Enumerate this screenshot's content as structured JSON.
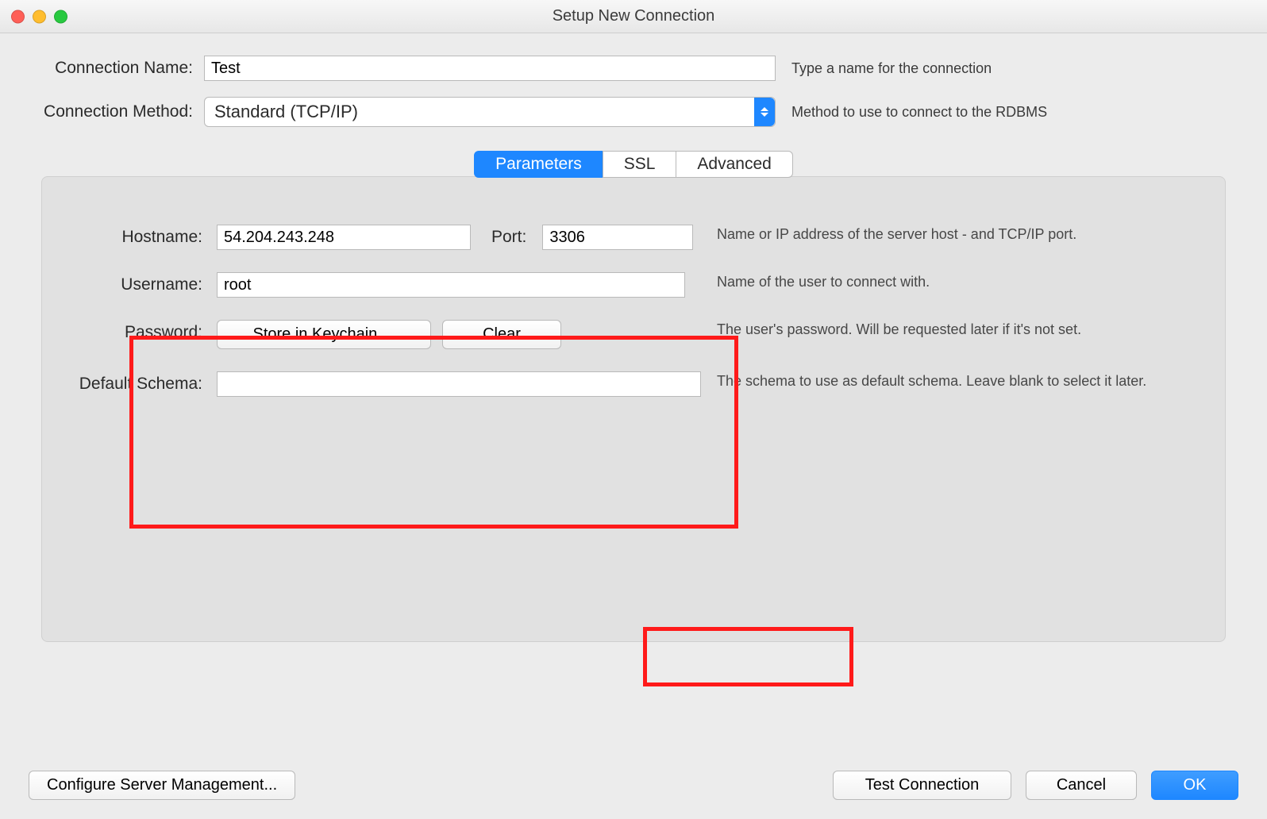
{
  "window": {
    "title": "Setup New Connection"
  },
  "connection_name": {
    "label": "Connection Name:",
    "value": "Test",
    "help": "Type a name for the connection"
  },
  "connection_method": {
    "label": "Connection Method:",
    "value": "Standard (TCP/IP)",
    "help": "Method to use to connect to the RDBMS"
  },
  "tabs": {
    "parameters": "Parameters",
    "ssl": "SSL",
    "advanced": "Advanced"
  },
  "params": {
    "hostname": {
      "label": "Hostname:",
      "value": "54.204.243.248",
      "port_label": "Port:",
      "port_value": "3306",
      "help": "Name or IP address of the server host - and TCP/IP port."
    },
    "username": {
      "label": "Username:",
      "value": "root",
      "help": "Name of the user to connect with."
    },
    "password": {
      "label": "Password:",
      "store_btn": "Store in Keychain ...",
      "clear_btn": "Clear",
      "help": "The user's password. Will be requested later if it's not set."
    },
    "default_schema": {
      "label": "Default Schema:",
      "value": "",
      "help": "The schema to use as default schema. Leave blank to select it later."
    }
  },
  "buttons": {
    "config_server": "Configure Server Management...",
    "test_connection": "Test Connection",
    "cancel": "Cancel",
    "ok": "OK"
  }
}
